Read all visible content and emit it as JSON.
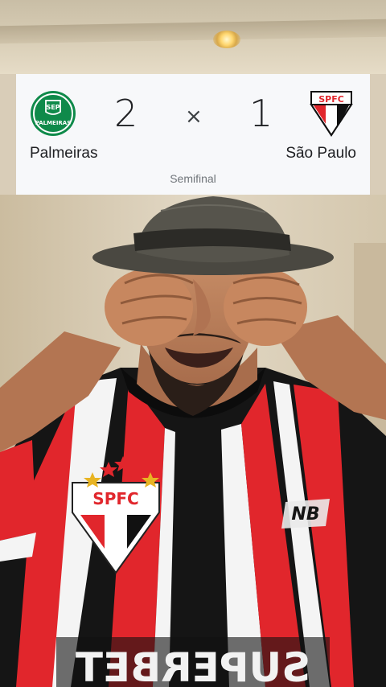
{
  "match": {
    "home_team": "Palmeiras",
    "away_team": "São Paulo",
    "home_score": "2",
    "away_score": "1",
    "separator": "×",
    "stage": "Semifinal"
  },
  "logos": {
    "home_text": "PALMEIRAS",
    "away_text": "SPFC"
  },
  "colors": {
    "palmeiras_green": "#0f8a4a",
    "spfc_red": "#e1262c",
    "spfc_black": "#111111",
    "card_bg": "#f7f8fa",
    "text_dark": "#202124",
    "text_muted": "#70757a"
  },
  "photo": {
    "shirt_crest_text": "SPFC",
    "shirt_sponsor_text": "SUPERBET"
  }
}
